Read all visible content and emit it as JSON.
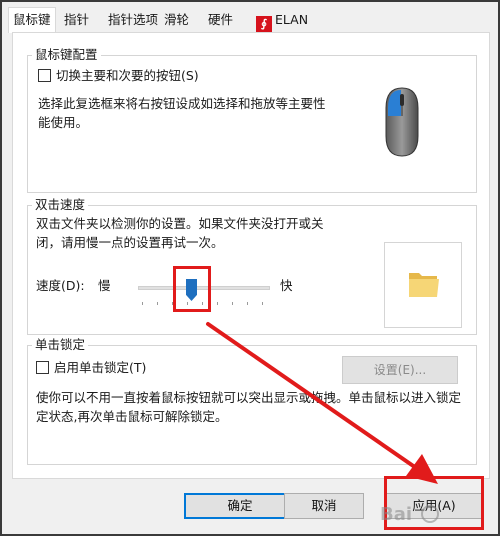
{
  "tabs": [
    {
      "label": "鼠标键"
    },
    {
      "label": "指针"
    },
    {
      "label": "指针选项"
    },
    {
      "label": "滑轮"
    },
    {
      "label": "硬件"
    },
    {
      "label": "ELAN"
    }
  ],
  "buttons_config": {
    "title": "鼠标键配置",
    "checkbox_label": "切换主要和次要的按钮(S)",
    "checked": false,
    "description_line1": "选择此复选框来将右按钮设成如选择和拖放等主要性",
    "description_line2": "能使用。"
  },
  "double_click": {
    "title": "双击速度",
    "description_line1": "双击文件夹以检测你的设置。如果文件夹没打开或关",
    "description_line2": "闭，请用慢一点的设置再试一次。",
    "speed_label": "速度(D):",
    "slow_label": "慢",
    "fast_label": "快",
    "slider_value": 0.4
  },
  "click_lock": {
    "title": "单击锁定",
    "checkbox_label": "启用单击锁定(T)",
    "checked": false,
    "settings_button": "设置(E)...",
    "description_line1": "使你可以不用一直按着鼠标按钮就可以突出显示或拖拽。单击鼠标以进入锁定",
    "description_line2": "定状态,再次单击鼠标可解除锁定。"
  },
  "footer": {
    "ok_label": "确定",
    "cancel_label": "取消",
    "apply_label": "应用(A)"
  },
  "colors": {
    "highlight": "#e11b1b",
    "accent": "#0078d7"
  }
}
